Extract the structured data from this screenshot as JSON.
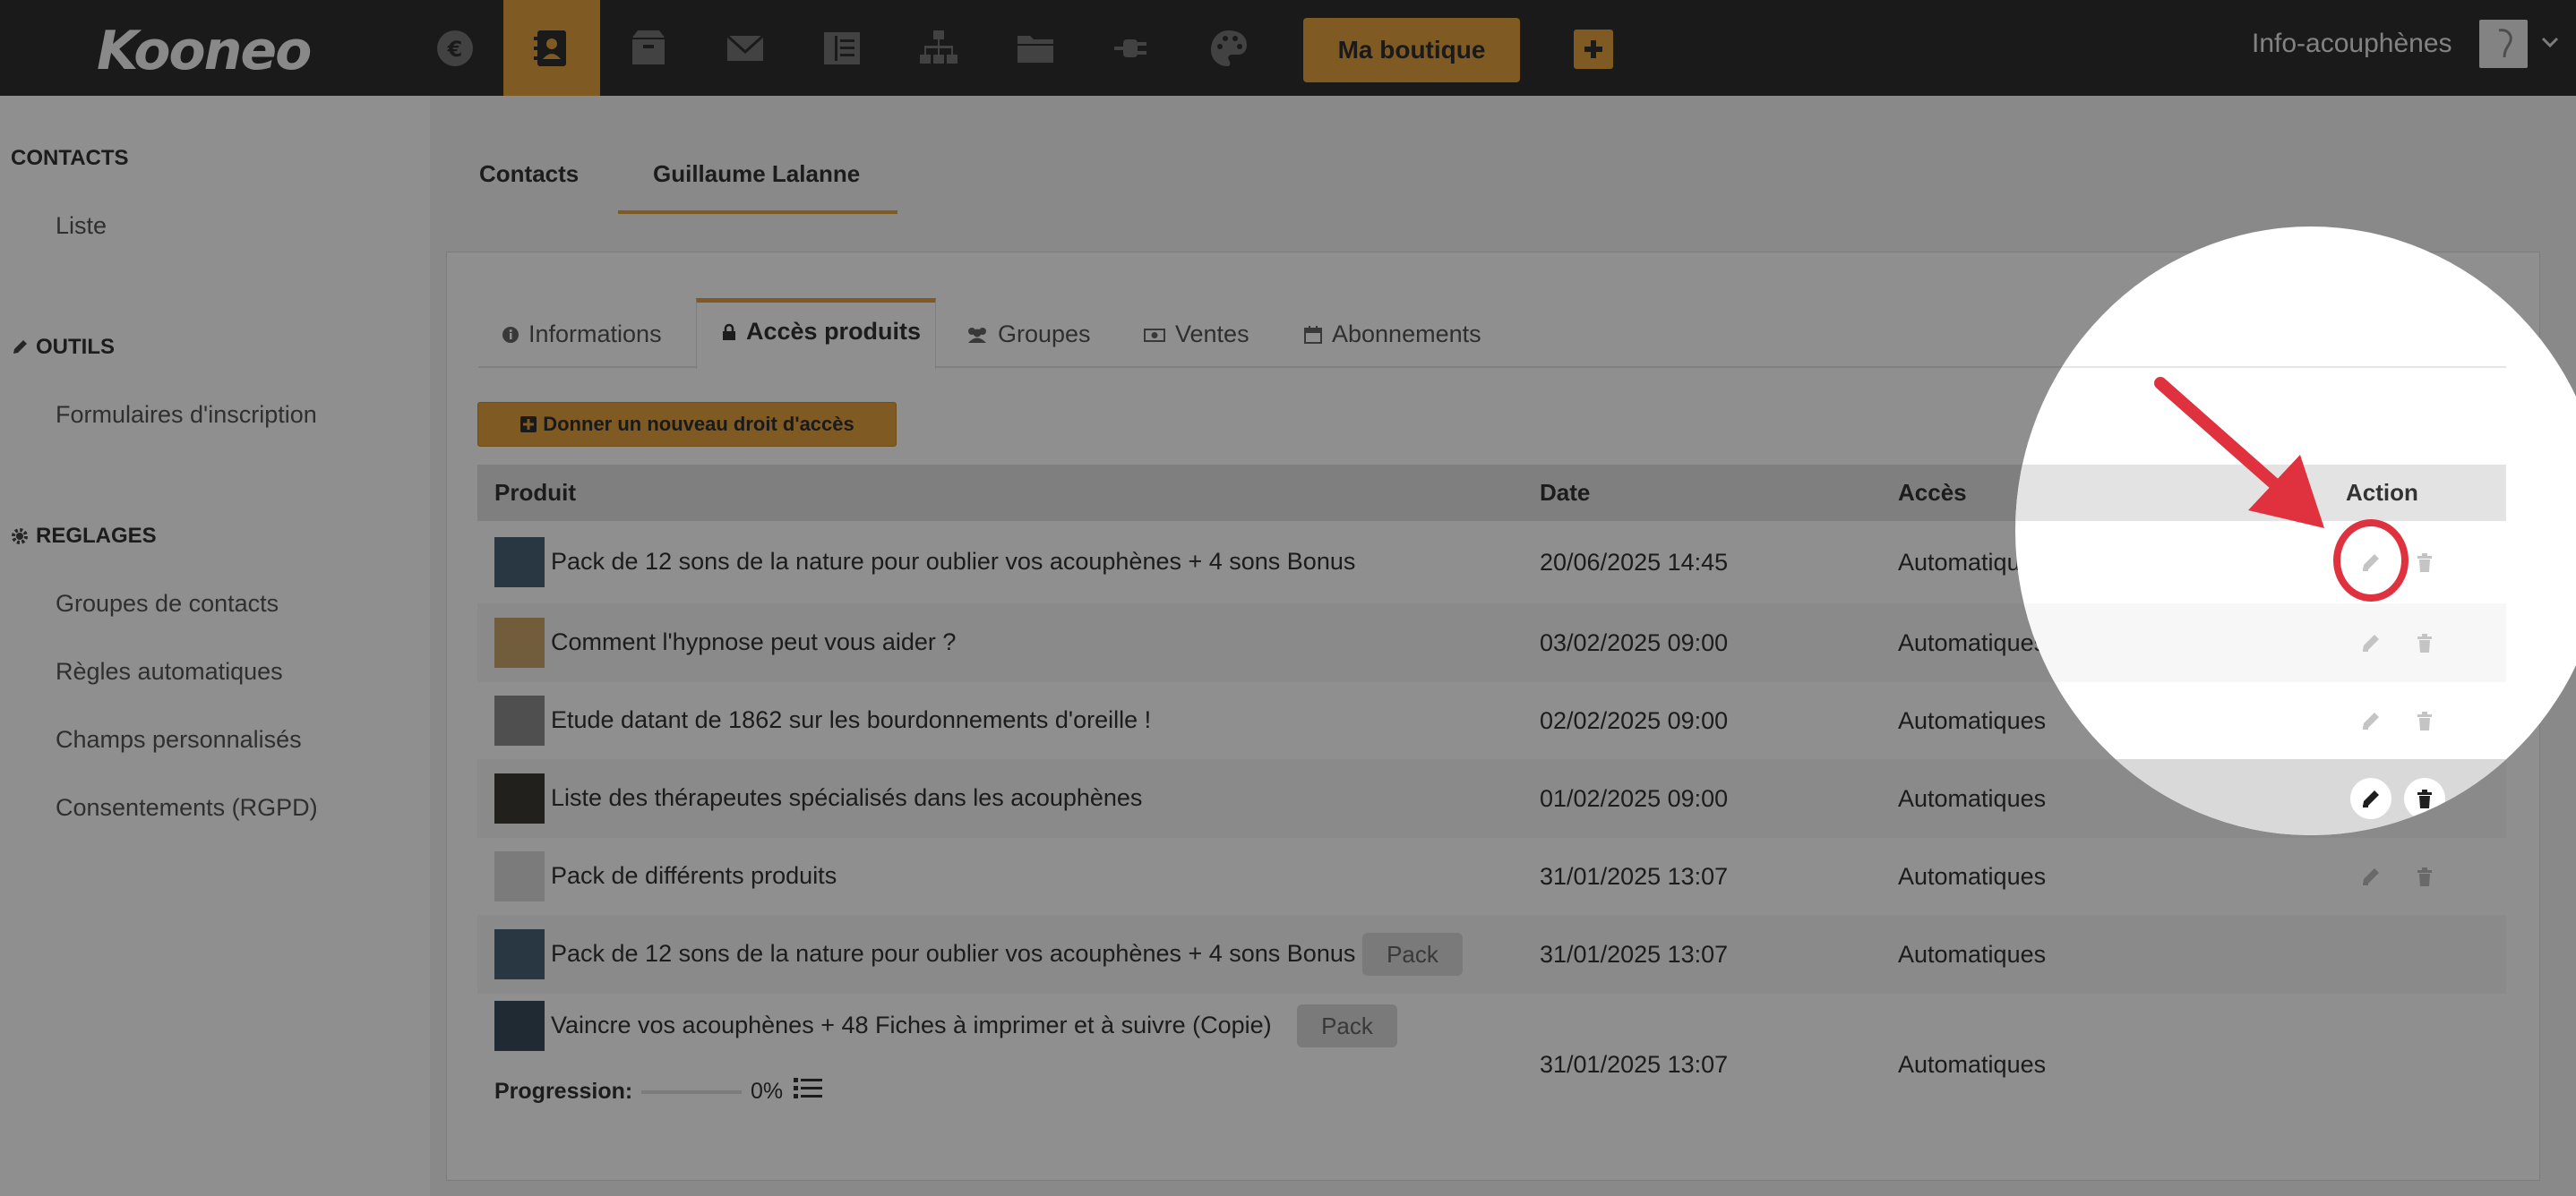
{
  "brand": {
    "logo": "Kooneo",
    "accent": "#e2a03f",
    "topbar_bg": "#2f2f2f",
    "highlight": "#e0313f"
  },
  "topbar": {
    "nav_icons": [
      "euro-icon",
      "contact-card-icon",
      "box-icon",
      "mail-icon",
      "columns-icon",
      "sitemap-icon",
      "folder-icon",
      "plug-icon",
      "palette-icon"
    ],
    "shop_button": "Ma boutique",
    "add_icon": "plus-icon",
    "account": "Info-acouphènes"
  },
  "sidebar": {
    "sections": [
      {
        "title": "CONTACTS",
        "icon": "",
        "items": [
          "Liste"
        ]
      },
      {
        "title": "OUTILS",
        "icon": "pencil-icon",
        "items": [
          "Formulaires d'inscription"
        ]
      },
      {
        "title": "REGLAGES",
        "icon": "gear-icon",
        "items": [
          "Groupes de contacts",
          "Règles automatiques",
          "Champs personnalisés",
          "Consentements (RGPD)"
        ]
      }
    ]
  },
  "page_tabs": [
    "Contacts",
    "Guillaume Lalanne"
  ],
  "inner_tabs": [
    {
      "label": "Informations",
      "icon": "info-icon"
    },
    {
      "label": "Accès produits",
      "icon": "lock-icon"
    },
    {
      "label": "Groupes",
      "icon": "users-icon"
    },
    {
      "label": "Ventes",
      "icon": "money-icon"
    },
    {
      "label": "Abonnements",
      "icon": "calendar-icon"
    }
  ],
  "grant_button": "Donner un nouveau droit d'accès",
  "table": {
    "headers": {
      "product": "Produit",
      "date": "Date",
      "access": "Accès",
      "action": "Action"
    },
    "rows": [
      {
        "product": "Pack de 12 sons de la nature pour oublier vos acouphènes + 4 sons Bonus",
        "date": "20/06/2025 14:45",
        "access": "Automatiques",
        "badge": ""
      },
      {
        "product": "Comment l'hypnose peut vous aider ?",
        "date": "03/02/2025 09:00",
        "access": "Automatiques",
        "badge": ""
      },
      {
        "product": "Etude datant de 1862 sur les bourdonnements d'oreille !",
        "date": "02/02/2025 09:00",
        "access": "Automatiques",
        "badge": ""
      },
      {
        "product": "Liste des thérapeutes spécialisés dans les acouphènes",
        "date": "01/02/2025 09:00",
        "access": "Automatiques",
        "badge": ""
      },
      {
        "product": "Pack de différents produits",
        "date": "31/01/2025 13:07",
        "access": "Automatiques",
        "badge": ""
      },
      {
        "product": "Pack de 12 sons de la nature pour oublier vos acouphènes + 4 sons Bonus",
        "date": "31/01/2025 13:07",
        "access": "Automatiques",
        "badge": "Pack"
      },
      {
        "product": "Vaincre vos acouphènes + 48 Fiches à imprimer et à suivre (Copie)",
        "date": "31/01/2025 13:07",
        "access": "Automatiques",
        "badge": "Pack"
      }
    ],
    "progress": {
      "label": "Progression:",
      "value_text": "0%",
      "value": 0
    }
  }
}
